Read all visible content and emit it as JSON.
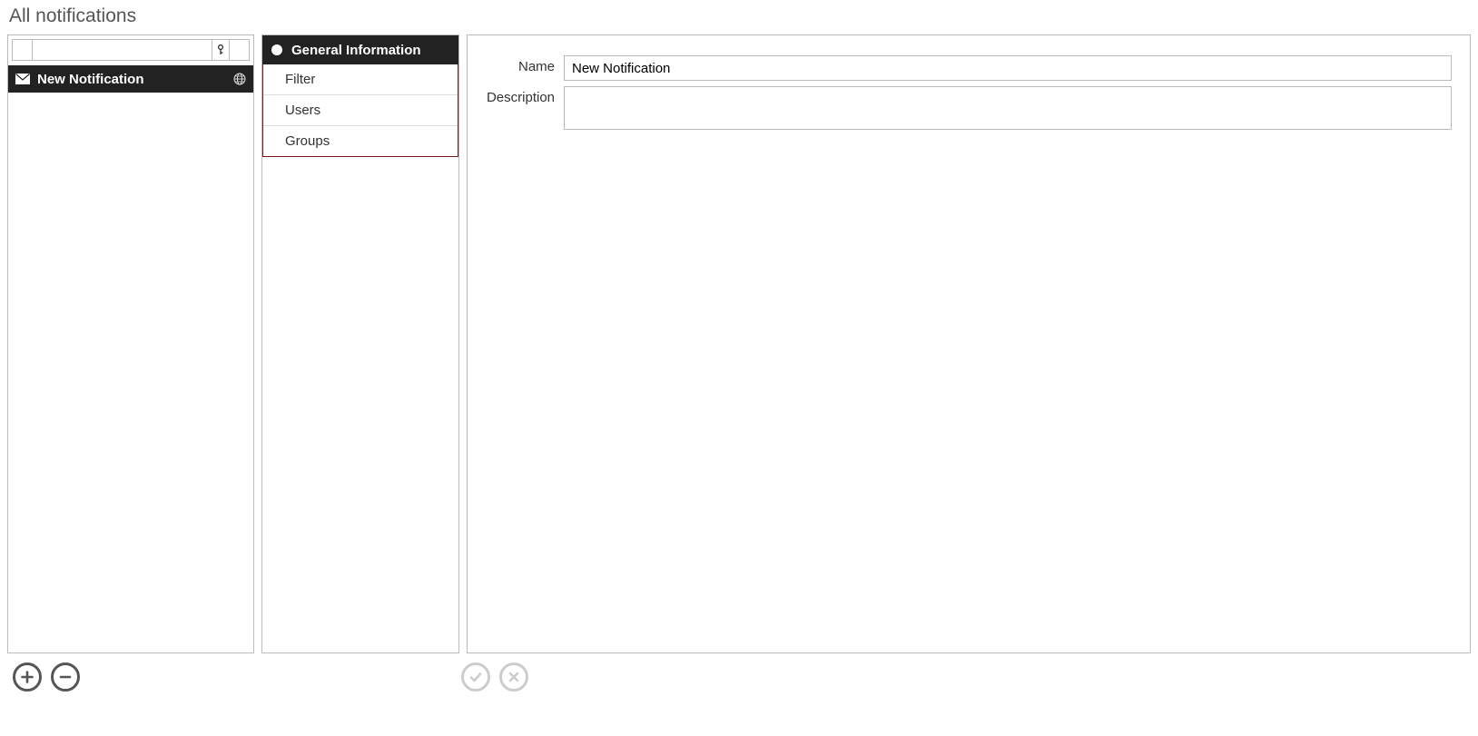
{
  "page": {
    "title": "All notifications"
  },
  "left": {
    "filter_value": "",
    "item": {
      "label": "New Notification"
    }
  },
  "mid": {
    "header": "General Information",
    "items": [
      "Filter",
      "Users",
      "Groups"
    ]
  },
  "form": {
    "name_label": "Name",
    "name_value": "New Notification",
    "description_label": "Description",
    "description_value": ""
  }
}
